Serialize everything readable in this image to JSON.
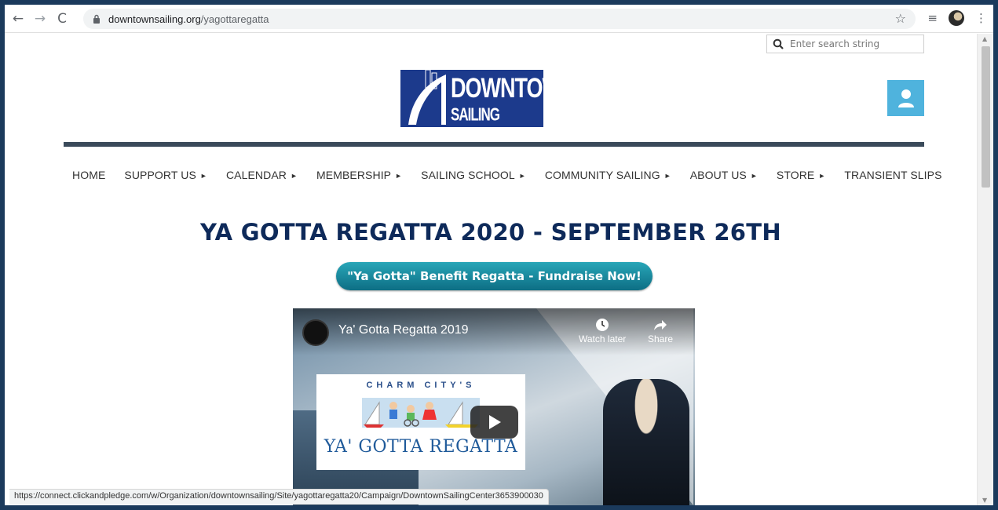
{
  "browser": {
    "url_domain": "downtownsailing.org",
    "url_path": "/yagottaregatta",
    "back_icon": "←",
    "forward_icon": "→",
    "reload_icon": "C",
    "bookmark_icon": "☆",
    "menu_icon": "⋮",
    "media_icon": "≡"
  },
  "search": {
    "placeholder": "Enter search string"
  },
  "logo": {
    "line1": "DOWNTOWN",
    "line2": "SAILING CENTER"
  },
  "nav": {
    "items": [
      {
        "label": "HOME",
        "arrow": ""
      },
      {
        "label": "SUPPORT US",
        "arrow": "►"
      },
      {
        "label": "CALENDAR",
        "arrow": "►"
      },
      {
        "label": "MEMBERSHIP",
        "arrow": "►"
      },
      {
        "label": "SAILING SCHOOL",
        "arrow": "►"
      },
      {
        "label": "COMMUNITY SAILING",
        "arrow": "►"
      },
      {
        "label": "ABOUT US",
        "arrow": "►"
      },
      {
        "label": "STORE",
        "arrow": "►"
      },
      {
        "label": "TRANSIENT SLIPS",
        "arrow": ""
      }
    ]
  },
  "main": {
    "title": "YA GOTTA REGATTA 2020 - SEPTEMBER 26TH",
    "cta_label": "\"Ya Gotta\" Benefit Regatta - Fundraise Now!"
  },
  "video": {
    "title": "Ya' Gotta Regatta 2019",
    "watch_later": "Watch later",
    "share": "Share",
    "promo_top": "CHARM CITY'S",
    "promo_main": "YA' GOTTA REGATTA"
  },
  "status_bar": {
    "url": "https://connect.clickandpledge.com/w/Organization/downtownsailing/Site/yagottaregatta20/Campaign/DowntownSailingCenter3653900030"
  },
  "colors": {
    "title": "#0e2a5a",
    "logo_bg": "#1c3a8c",
    "user_button": "#4fb3dd",
    "cta_gradient_top": "#28a6b8",
    "cta_gradient_bottom": "#0d6e84"
  }
}
